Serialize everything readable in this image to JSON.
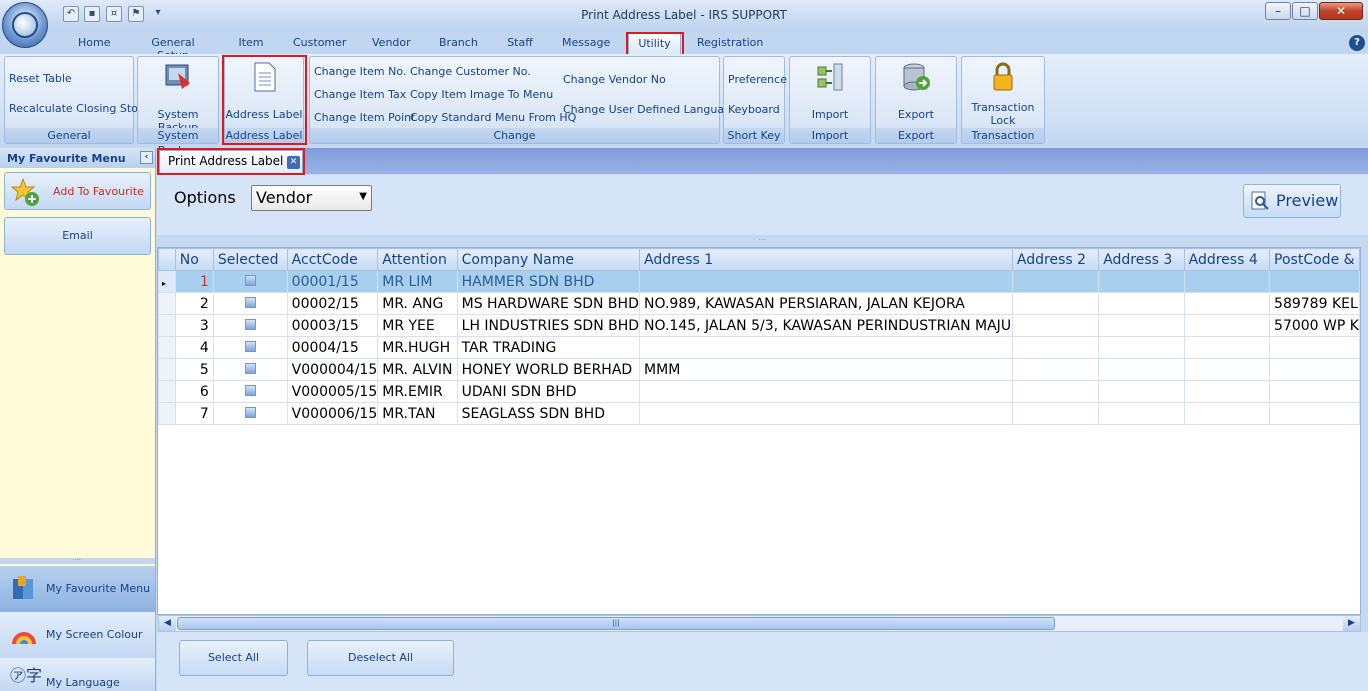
{
  "window": {
    "title": "Print Address Label - IRS SUPPORT"
  },
  "menu_tabs": [
    "Home",
    "General Setup",
    "Item",
    "Customer",
    "Vendor",
    "Branch",
    "Staff",
    "Message",
    "Utility",
    "Registration"
  ],
  "ribbon": {
    "general": {
      "items": [
        "Reset Table",
        "Recalculate Closing Stock"
      ],
      "title": "General"
    },
    "system_backup": {
      "label": "System Backup",
      "title": "System Backup"
    },
    "address_label": {
      "label": "Address Label",
      "title": "Address Label"
    },
    "change": {
      "col1": [
        "Change Item No.",
        "Change Item Tax",
        "Change Item Point"
      ],
      "col2": [
        "Change Customer No.",
        "Copy Item Image To Menu",
        "Copy Standard Menu From HQ"
      ],
      "col3": [
        "Change Vendor No",
        "Change User Defined Language"
      ],
      "title": "Change"
    },
    "short_key": {
      "items": [
        "Preference",
        "Keyboard"
      ],
      "title": "Short Key"
    },
    "import": {
      "label": "Import",
      "title": "Import"
    },
    "export": {
      "label": "Export",
      "title": "Export"
    },
    "transaction": {
      "label1": "Transaction",
      "label2": "Lock",
      "title": "Transaction"
    }
  },
  "sidebar": {
    "header": "My Favourite Menu",
    "add_favourite": "Add To Favourite",
    "email": "Email",
    "nav": [
      "My Favourite Menu",
      "My Screen Colour",
      "My Language"
    ]
  },
  "doc_tab": "Print Address Label",
  "options": {
    "label": "Options",
    "value": "Vendor"
  },
  "preview_label": "Preview",
  "grid": {
    "columns": [
      "No",
      "Selected",
      "AcctCode",
      "Attention",
      "Company Name",
      "Address 1",
      "Address 2",
      "Address 3",
      "Address 4",
      "PostCode &"
    ],
    "rows": [
      {
        "no": "1",
        "acct": "00001/15",
        "attn": "MR LIM",
        "company": "HAMMER SDN BHD",
        "addr1": "",
        "postcode": ""
      },
      {
        "no": "2",
        "acct": "00002/15",
        "attn": "MR. ANG",
        "company": "MS HARDWARE SDN BHD",
        "addr1": "NO.989, KAWASAN PERSIARAN, JALAN KEJORA",
        "postcode": "589789 KEL"
      },
      {
        "no": "3",
        "acct": "00003/15",
        "attn": "MR YEE",
        "company": "LH INDUSTRIES SDN BHD",
        "addr1": "NO.145, JALAN 5/3, KAWASAN PERINDUSTRIAN MAJU",
        "postcode": "57000 WP K"
      },
      {
        "no": "4",
        "acct": "00004/15",
        "attn": "MR.HUGH",
        "company": "TAR TRADING",
        "addr1": "",
        "postcode": ""
      },
      {
        "no": "5",
        "acct": "V000004/15",
        "attn": "MR. ALVIN",
        "company": "HONEY WORLD BERHAD",
        "addr1": "MMM",
        "postcode": ""
      },
      {
        "no": "6",
        "acct": "V000005/15",
        "attn": "MR.EMIR",
        "company": "UDANI SDN BHD",
        "addr1": "",
        "postcode": ""
      },
      {
        "no": "7",
        "acct": "V000006/15",
        "attn": "MR.TAN",
        "company": "SEAGLASS SDN BHD",
        "addr1": "",
        "postcode": ""
      }
    ]
  },
  "buttons": {
    "select_all": "Select All",
    "deselect_all": "Deselect All"
  },
  "colors": {
    "highlight": "#e0191d",
    "selected_row": "#a9cfef"
  }
}
